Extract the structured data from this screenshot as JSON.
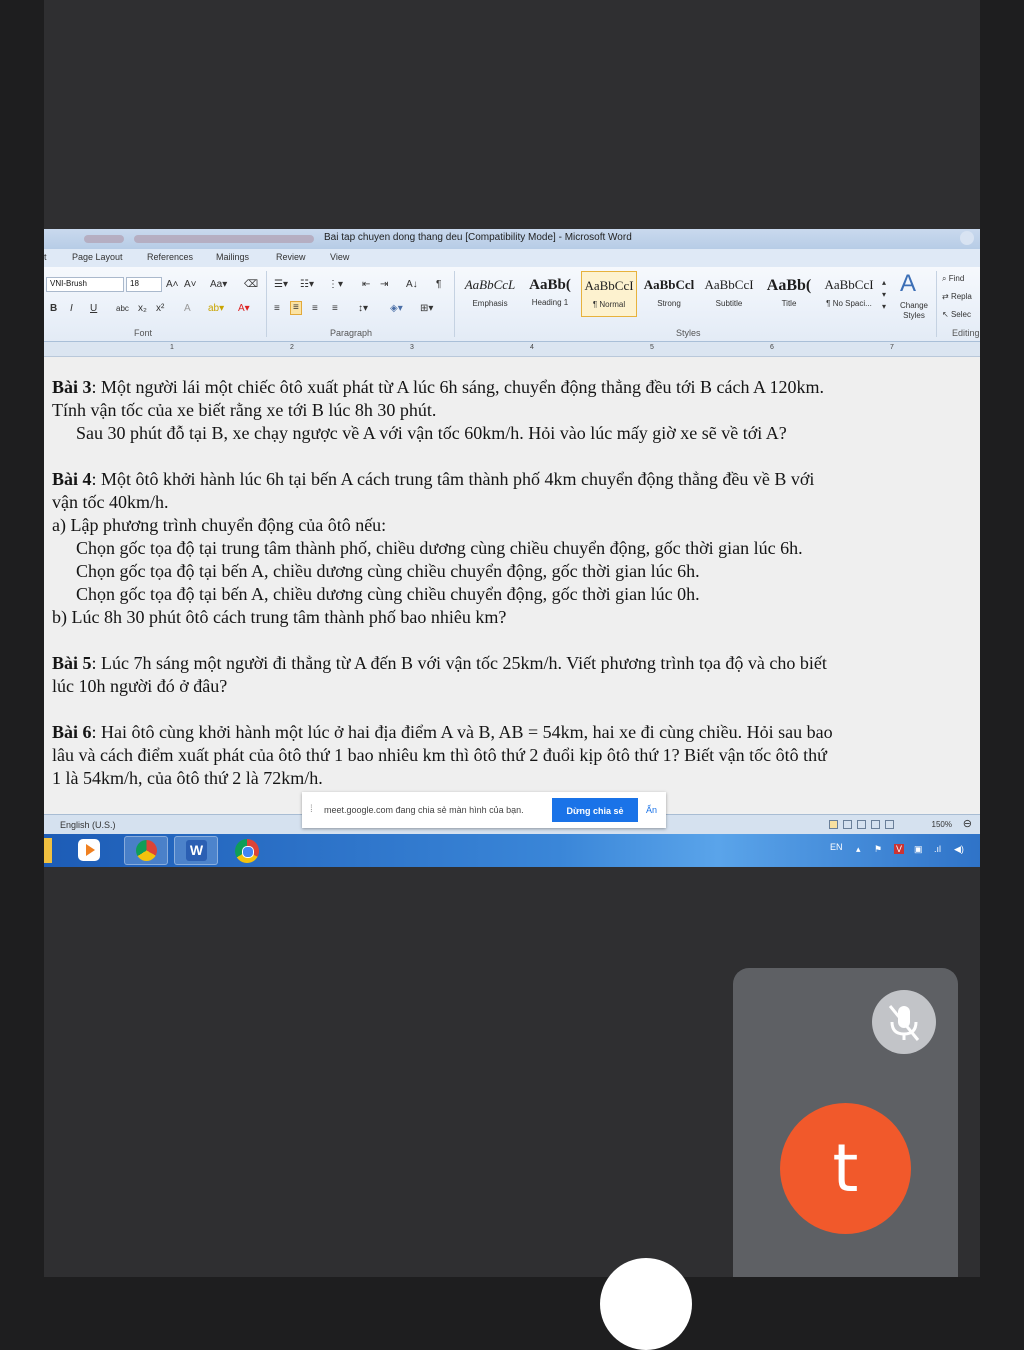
{
  "word": {
    "title": "Bai tap chuyen dong thang deu [Compatibility Mode] - Microsoft Word",
    "tabs": [
      "t",
      "Page Layout",
      "References",
      "Mailings",
      "Review",
      "View"
    ],
    "font": {
      "name": "VNI-Brush",
      "size": "18",
      "group_label": "Font"
    },
    "paragraph_group_label": "Paragraph",
    "styles": [
      {
        "preview": "AaBbCcL",
        "name": "Emphasis"
      },
      {
        "preview": "AaBb(",
        "name": "Heading 1"
      },
      {
        "preview": "AaBbCcI",
        "name": "¶ Normal"
      },
      {
        "preview": "AaBbCcl",
        "name": "Strong"
      },
      {
        "preview": "AaBbCcI",
        "name": "Subtitle"
      },
      {
        "preview": "AaBb(",
        "name": "Title"
      },
      {
        "preview": "AaBbCcI",
        "name": "¶ No Spaci..."
      }
    ],
    "styles_group_label": "Styles",
    "change_styles": "Change Styles",
    "editing": {
      "find": "Find",
      "replace": "Repla",
      "select": "Selec",
      "group_label": "Editing"
    },
    "ruler_numbers": [
      "1",
      "2",
      "3",
      "4",
      "5",
      "6",
      "7"
    ],
    "status": {
      "language": "English (U.S.)",
      "zoom": "150%"
    }
  },
  "document": {
    "bai3": {
      "label": "Bài 3",
      "l1": ": Một người lái một chiếc ôtô xuất phát từ A lúc 6h sáng, chuyển động thẳng đều tới B cách A 120km.",
      "l2": "Tính vận tốc của xe biết rằng xe tới B lúc 8h 30 phút.",
      "l3": "Sau 30 phút đỗ tại B, xe chạy ngược về A với vận tốc 60km/h. Hỏi vào lúc mấy giờ xe sẽ về tới A?"
    },
    "bai4": {
      "label": "Bài 4",
      "l1": ": Một ôtô khởi hành lúc 6h tại bến A cách trung tâm thành phố 4km chuyển động thẳng đều về B với",
      "l2": "vận tốc 40km/h.",
      "l3": "a) Lập phương trình chuyển động của ôtô nếu:",
      "l4": "Chọn gốc tọa độ tại trung tâm thành phố, chiều dương cùng chiều chuyển động, gốc thời gian lúc 6h.",
      "l5": "Chọn gốc tọa độ tại bến A, chiều dương cùng chiều chuyển động, gốc thời gian lúc 6h.",
      "l6": "Chọn gốc tọa độ tại bến A, chiều dương cùng chiều chuyển động, gốc thời gian lúc 0h.",
      "l7": "b) Lúc 8h 30 phút ôtô cách trung tâm thành phố bao nhiêu km?"
    },
    "bai5": {
      "label": "Bài 5",
      "l1": ": Lúc 7h sáng một người đi thẳng từ A đến B với vận tốc 25km/h. Viết phương trình tọa độ và cho biết",
      "l2": "lúc 10h người đó ở đâu?"
    },
    "bai6": {
      "label": "Bài 6",
      "l1": ": Hai ôtô cùng khởi hành một lúc ở hai địa điểm A và B, AB = 54km, hai xe đi cùng chiều. Hỏi sau bao",
      "l2": "lâu và cách điểm xuất phát của ôtô thứ 1 bao nhiêu km thì ôtô thứ 2 đuổi kịp ôtô thứ 1? Biết vận tốc ôtô thứ",
      "l3": "1 là 54km/h, của ôtô thứ 2 là 72km/h."
    }
  },
  "share_banner": {
    "message": "meet.google.com đang chia sẻ màn hình của bạn.",
    "stop_button": "Dừng chia sẻ",
    "hide_link": "Ẩn"
  },
  "taskbar": {
    "lang": "EN"
  },
  "self_view": {
    "avatar_letter": "t",
    "avatar_color": "#f1592b",
    "mic_state": "muted"
  }
}
